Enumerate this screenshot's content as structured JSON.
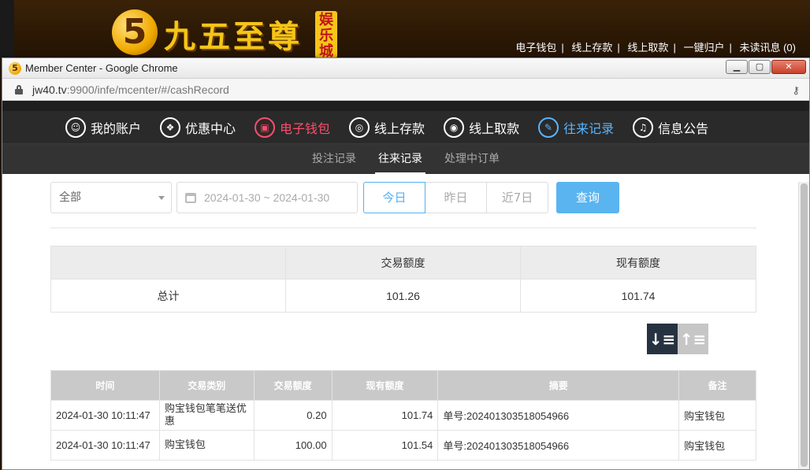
{
  "site": {
    "logo_glyph": "5",
    "logo_text": "九五至尊",
    "logo_badge": "娱乐城",
    "links": [
      "电子钱包",
      "线上存款",
      "线上取款",
      "一键归户",
      "未读讯息 (0)"
    ]
  },
  "window": {
    "title": "Member Center - Google Chrome",
    "url_host": "jw40.tv",
    "url_path": ":9900/infe/mcenter/#/cashRecord"
  },
  "mainnav": [
    {
      "label": "我的账户",
      "icon": "user-icon",
      "glyph": "☺"
    },
    {
      "label": "优惠中心",
      "icon": "gift-icon",
      "glyph": "❖"
    },
    {
      "label": "电子钱包",
      "icon": "wallet-icon",
      "glyph": "▣"
    },
    {
      "label": "线上存款",
      "icon": "deposit-icon",
      "glyph": "◎"
    },
    {
      "label": "线上取款",
      "icon": "withdraw-icon",
      "glyph": "◉"
    },
    {
      "label": "往来记录",
      "icon": "record-icon",
      "glyph": "✎"
    },
    {
      "label": "信息公告",
      "icon": "bell-icon",
      "glyph": "♫"
    }
  ],
  "subnav": [
    "投注记录",
    "往来记录",
    "处理中订单"
  ],
  "filter": {
    "type_selected": "全部",
    "date_range": "2024-01-30 ~ 2024-01-30",
    "quick": [
      "今日",
      "昨日",
      "近7日"
    ],
    "query_label": "查询"
  },
  "summary": {
    "headers": [
      "",
      "交易额度",
      "现有额度"
    ],
    "row": [
      "总计",
      "101.26",
      "101.74"
    ]
  },
  "records": {
    "headers": [
      "时间",
      "交易类别",
      "交易额度",
      "现有额度",
      "摘要",
      "备注"
    ],
    "rows": [
      [
        "2024-01-30 10:11:47",
        "购宝钱包笔笔送优惠",
        "0.20",
        "101.74",
        "单号:202401303518054966",
        "购宝钱包"
      ],
      [
        "2024-01-30 10:11:47",
        "购宝钱包",
        "100.00",
        "101.54",
        "单号:202401303518054966",
        "购宝钱包"
      ]
    ]
  },
  "colors": {
    "active_nav": "#ff4d6a",
    "accent_blue": "#5ab4f0",
    "sort_active": "#263240"
  }
}
